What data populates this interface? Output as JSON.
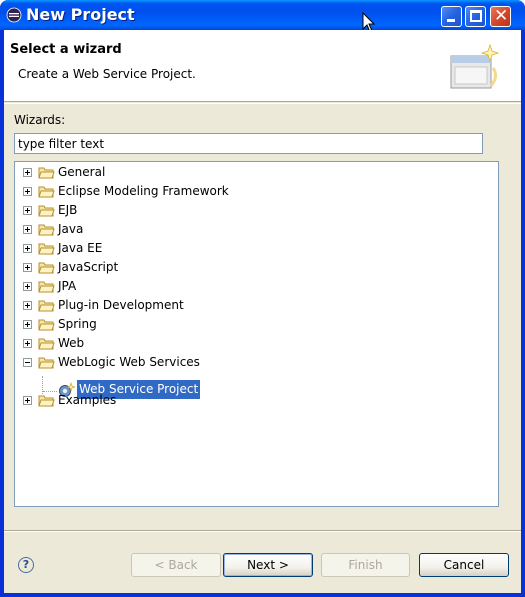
{
  "window": {
    "title": "New Project"
  },
  "header": {
    "title": "Select a wizard",
    "description": "Create a Web Service Project."
  },
  "wizards": {
    "label": "Wizards:",
    "filter_value": "type filter text",
    "tree": [
      {
        "label": "General",
        "expanded": false
      },
      {
        "label": "Eclipse Modeling Framework",
        "expanded": false
      },
      {
        "label": "EJB",
        "expanded": false
      },
      {
        "label": "Java",
        "expanded": false
      },
      {
        "label": "Java EE",
        "expanded": false
      },
      {
        "label": "JavaScript",
        "expanded": false
      },
      {
        "label": "JPA",
        "expanded": false
      },
      {
        "label": "Plug-in Development",
        "expanded": false
      },
      {
        "label": "Spring",
        "expanded": false
      },
      {
        "label": "Web",
        "expanded": false
      },
      {
        "label": "WebLogic Web Services",
        "expanded": true,
        "children": [
          {
            "label": "Web Service Project",
            "selected": true
          }
        ]
      },
      {
        "label": "Examples",
        "expanded": false
      }
    ]
  },
  "buttons": {
    "help": "?",
    "back": "< Back",
    "next": "Next >",
    "finish": "Finish",
    "cancel": "Cancel"
  },
  "colors": {
    "selection": "#316ac5",
    "titlebar": "#0053ee",
    "dialog_bg": "#ece9d8"
  }
}
